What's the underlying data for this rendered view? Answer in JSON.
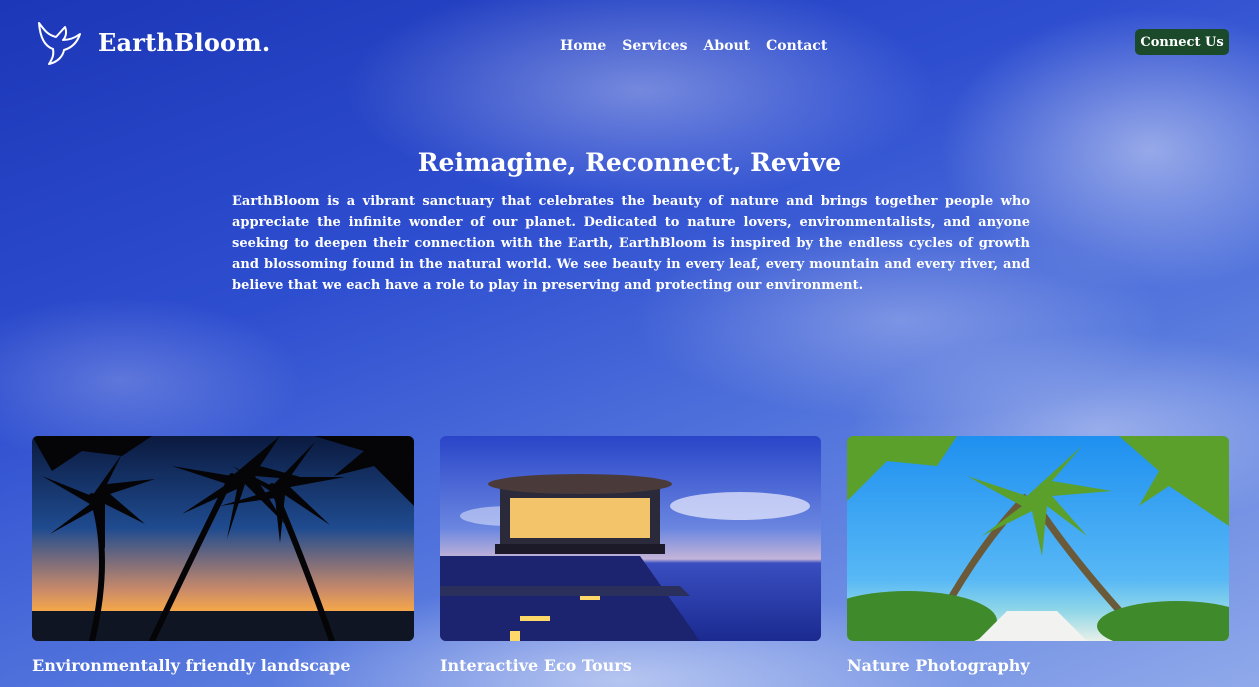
{
  "brand": {
    "name": "EarthBloom.",
    "logo_icon": "dove-icon"
  },
  "nav": {
    "items": [
      "Home",
      "Services",
      "About",
      "Contact"
    ]
  },
  "header": {
    "cta_label": "Connect Us",
    "cta_color": "#1a4a2a"
  },
  "hero": {
    "title": "Reimagine, Reconnect, Revive",
    "text": "EarthBloom is a vibrant sanctuary that celebrates the beauty of nature and brings together people who appreciate the infinite wonder of our planet. Dedicated to nature lovers, environmentalists, and anyone seeking to deepen their connection with the Earth, EarthBloom is inspired by the endless cycles of growth and blossoming found in the natural world. We see beauty in every leaf, every mountain and every river, and believe that we each have a role to play in preserving and protecting our environment."
  },
  "cards": [
    {
      "caption": "Environmentally friendly landscape",
      "image": "sunset-palm-beach"
    },
    {
      "caption": "Interactive Eco Tours",
      "image": "overwater-pavilion"
    },
    {
      "caption": "Nature Photography",
      "image": "tropical-palm-beach"
    }
  ]
}
